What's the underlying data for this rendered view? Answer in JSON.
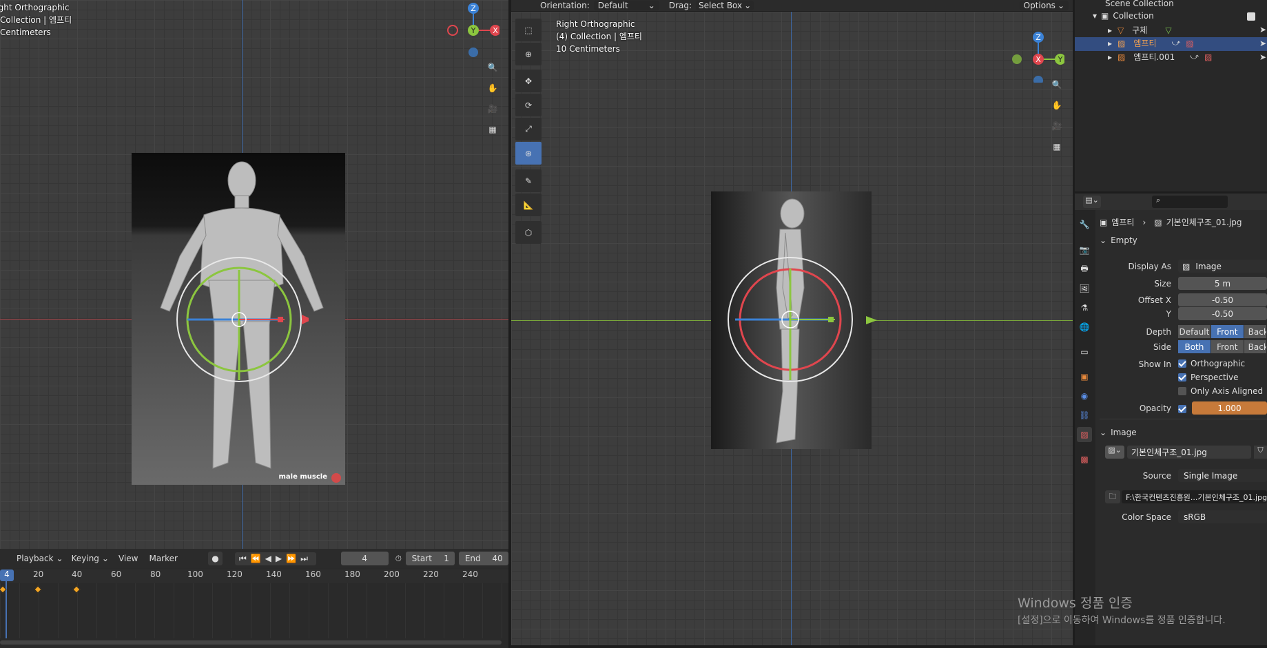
{
  "left_viewport": {
    "view_name": "Right Orthographic",
    "collection": "Collection | 엠프티",
    "scale": "Centimeters"
  },
  "right_viewport": {
    "view_name": "Right Orthographic",
    "collection": "(4) Collection | 엠프티",
    "scale": "10 Centimeters"
  },
  "header": {
    "orientation_label": "Orientation:",
    "orientation_value": "Default",
    "drag_label": "Drag:",
    "drag_value": "Select Box",
    "options_label": "Options"
  },
  "gizmo": {
    "x": "X",
    "y": "Y",
    "z": "Z"
  },
  "image_caption": "male muscle",
  "timeline": {
    "menus": [
      "Playback",
      "Keying",
      "View",
      "Marker"
    ],
    "current_frame": "4",
    "start_label": "Start",
    "start_value": "1",
    "end_label": "End",
    "end_value": "40",
    "ticks": [
      "4",
      "20",
      "40",
      "60",
      "80",
      "100",
      "120",
      "140",
      "160",
      "180",
      "200",
      "220",
      "240"
    ]
  },
  "outliner": {
    "scene_collection": "Scene Collection",
    "collection": "Collection",
    "items": [
      "구체",
      "엠프티",
      "엠프티.001"
    ]
  },
  "properties": {
    "breadcrumb_object": "엠프티",
    "breadcrumb_data": "기본인체구조_01.jpg",
    "empty_section": "Empty",
    "display_as_label": "Display As",
    "display_as_value": "Image",
    "size_label": "Size",
    "size_value": "5 m",
    "offset_x_label": "Offset X",
    "offset_x_value": "-0.50",
    "offset_y_label": "Y",
    "offset_y_value": "-0.50",
    "depth_label": "Depth",
    "depth_options": [
      "Default",
      "Front",
      "Back"
    ],
    "side_label": "Side",
    "side_options": [
      "Both",
      "Front",
      "Back"
    ],
    "show_in_label": "Show In",
    "show_orthographic": "Orthographic",
    "show_perspective": "Perspective",
    "show_axis_aligned": "Only Axis Aligned",
    "opacity_label": "Opacity",
    "opacity_value": "1.000",
    "opacity_fraction": 1.0,
    "image_section": "Image",
    "image_name": "기본인체구조_01.jpg",
    "source_label": "Source",
    "source_value": "Single Image",
    "filepath": "F:\\한국컨텐츠진흥원...기본인체구조_01.jpg",
    "color_space_label": "Color Space",
    "color_space_value": "sRGB"
  },
  "watermark": {
    "title": "Windows 정품 인증",
    "subtitle": "[설정]으로 이동하여 Windows를 정품 인증합니다."
  },
  "colors": {
    "accent": "#4772b3",
    "x_axis": "#e0464e",
    "y_axis": "#8cc63f",
    "z_axis": "#3b82d6",
    "keyframe": "#f5a623",
    "opacity_bar": "#c77a3a"
  }
}
